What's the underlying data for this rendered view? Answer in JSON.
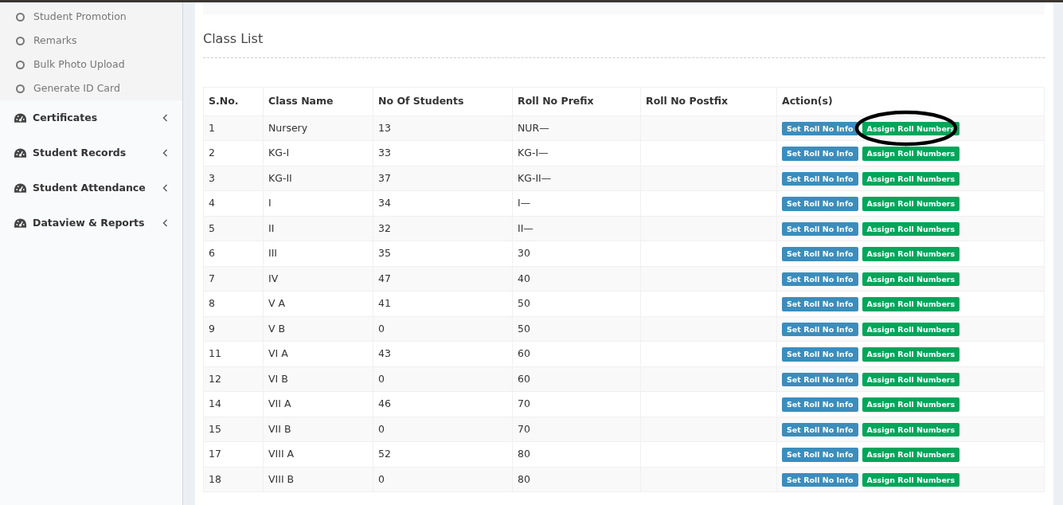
{
  "sidebar": {
    "subitems": [
      {
        "label": "Student Promotion"
      },
      {
        "label": "Remarks"
      },
      {
        "label": "Bulk Photo Upload"
      },
      {
        "label": "Generate ID Card"
      }
    ],
    "items": [
      {
        "label": "Certificates",
        "expanded": false
      },
      {
        "label": "Student Records",
        "expanded": false
      },
      {
        "label": "Student Attendance",
        "expanded": false
      },
      {
        "label": "Dataview & Reports",
        "expanded": false
      }
    ]
  },
  "panel": {
    "title": "Class List"
  },
  "table": {
    "columns": [
      "S.No.",
      "Class Name",
      "No Of Students",
      "Roll No Prefix",
      "Roll No Postfix",
      "Action(s)"
    ],
    "rows": [
      {
        "sno": "1",
        "class_name": "Nursery",
        "students": "13",
        "prefix": "NUR—",
        "circled": true,
        "actions": [
          "Set Roll No Info",
          "Assign Roll Numbers"
        ]
      },
      {
        "sno": "2",
        "class_name": "KG-I",
        "students": "33",
        "prefix": "KG-I—",
        "circled": false,
        "actions": [
          "Set Roll No Info",
          "Assign Roll Numbers"
        ]
      },
      {
        "sno": "3",
        "class_name": "KG-II",
        "students": "37",
        "prefix": "KG-II—",
        "circled": false,
        "actions": [
          "Set Roll No Info",
          "Assign Roll Numbers"
        ]
      },
      {
        "sno": "4",
        "class_name": "I",
        "students": "34",
        "prefix": "I—",
        "circled": false,
        "actions": [
          "Set Roll No Info",
          "Assign Roll Numbers"
        ]
      },
      {
        "sno": "5",
        "class_name": "II",
        "students": "32",
        "prefix": "II—",
        "circled": false,
        "actions": [
          "Set Roll No Info",
          "Assign Roll Numbers"
        ]
      },
      {
        "sno": "6",
        "class_name": "III",
        "students": "35",
        "prefix": "30",
        "circled": false,
        "actions": [
          "Set Roll No Info",
          "Assign Roll Numbers"
        ]
      },
      {
        "sno": "7",
        "class_name": "IV",
        "students": "47",
        "prefix": "40",
        "circled": false,
        "actions": [
          "Set Roll No Info",
          "Assign Roll Numbers"
        ]
      },
      {
        "sno": "8",
        "class_name": "V A",
        "students": "41",
        "prefix": "50",
        "circled": false,
        "actions": [
          "Set Roll No Info",
          "Assign Roll Numbers"
        ]
      },
      {
        "sno": "9",
        "class_name": "V B",
        "students": "0",
        "prefix": "50",
        "circled": false,
        "actions": [
          "Set Roll No Info",
          "Assign Roll Numbers"
        ]
      },
      {
        "sno": "11",
        "class_name": "VI A",
        "students": "43",
        "prefix": "60",
        "circled": false,
        "actions": [
          "Set Roll No Info",
          "Assign Roll Numbers"
        ]
      },
      {
        "sno": "12",
        "class_name": "VI B",
        "students": "0",
        "prefix": "60",
        "circled": false,
        "actions": [
          "Set Roll No Info",
          "Assign Roll Numbers"
        ]
      },
      {
        "sno": "14",
        "class_name": "VII A",
        "students": "46",
        "prefix": "70",
        "circled": false,
        "actions": [
          "Set Roll No Info",
          "Assign Roll Numbers"
        ]
      },
      {
        "sno": "15",
        "class_name": "VII B",
        "students": "0",
        "prefix": "70",
        "circled": false,
        "actions": [
          "Set Roll No Info",
          "Assign Roll Numbers"
        ]
      },
      {
        "sno": "17",
        "class_name": "VIII A",
        "students": "52",
        "prefix": "80",
        "circled": false,
        "actions": [
          "Set Roll No Info",
          "Assign Roll Numbers"
        ]
      },
      {
        "sno": "18",
        "class_name": "VIII B",
        "students": "0",
        "prefix": "80",
        "circled": false,
        "actions": [
          "Set Roll No Info",
          "Assign Roll Numbers"
        ]
      }
    ]
  }
}
